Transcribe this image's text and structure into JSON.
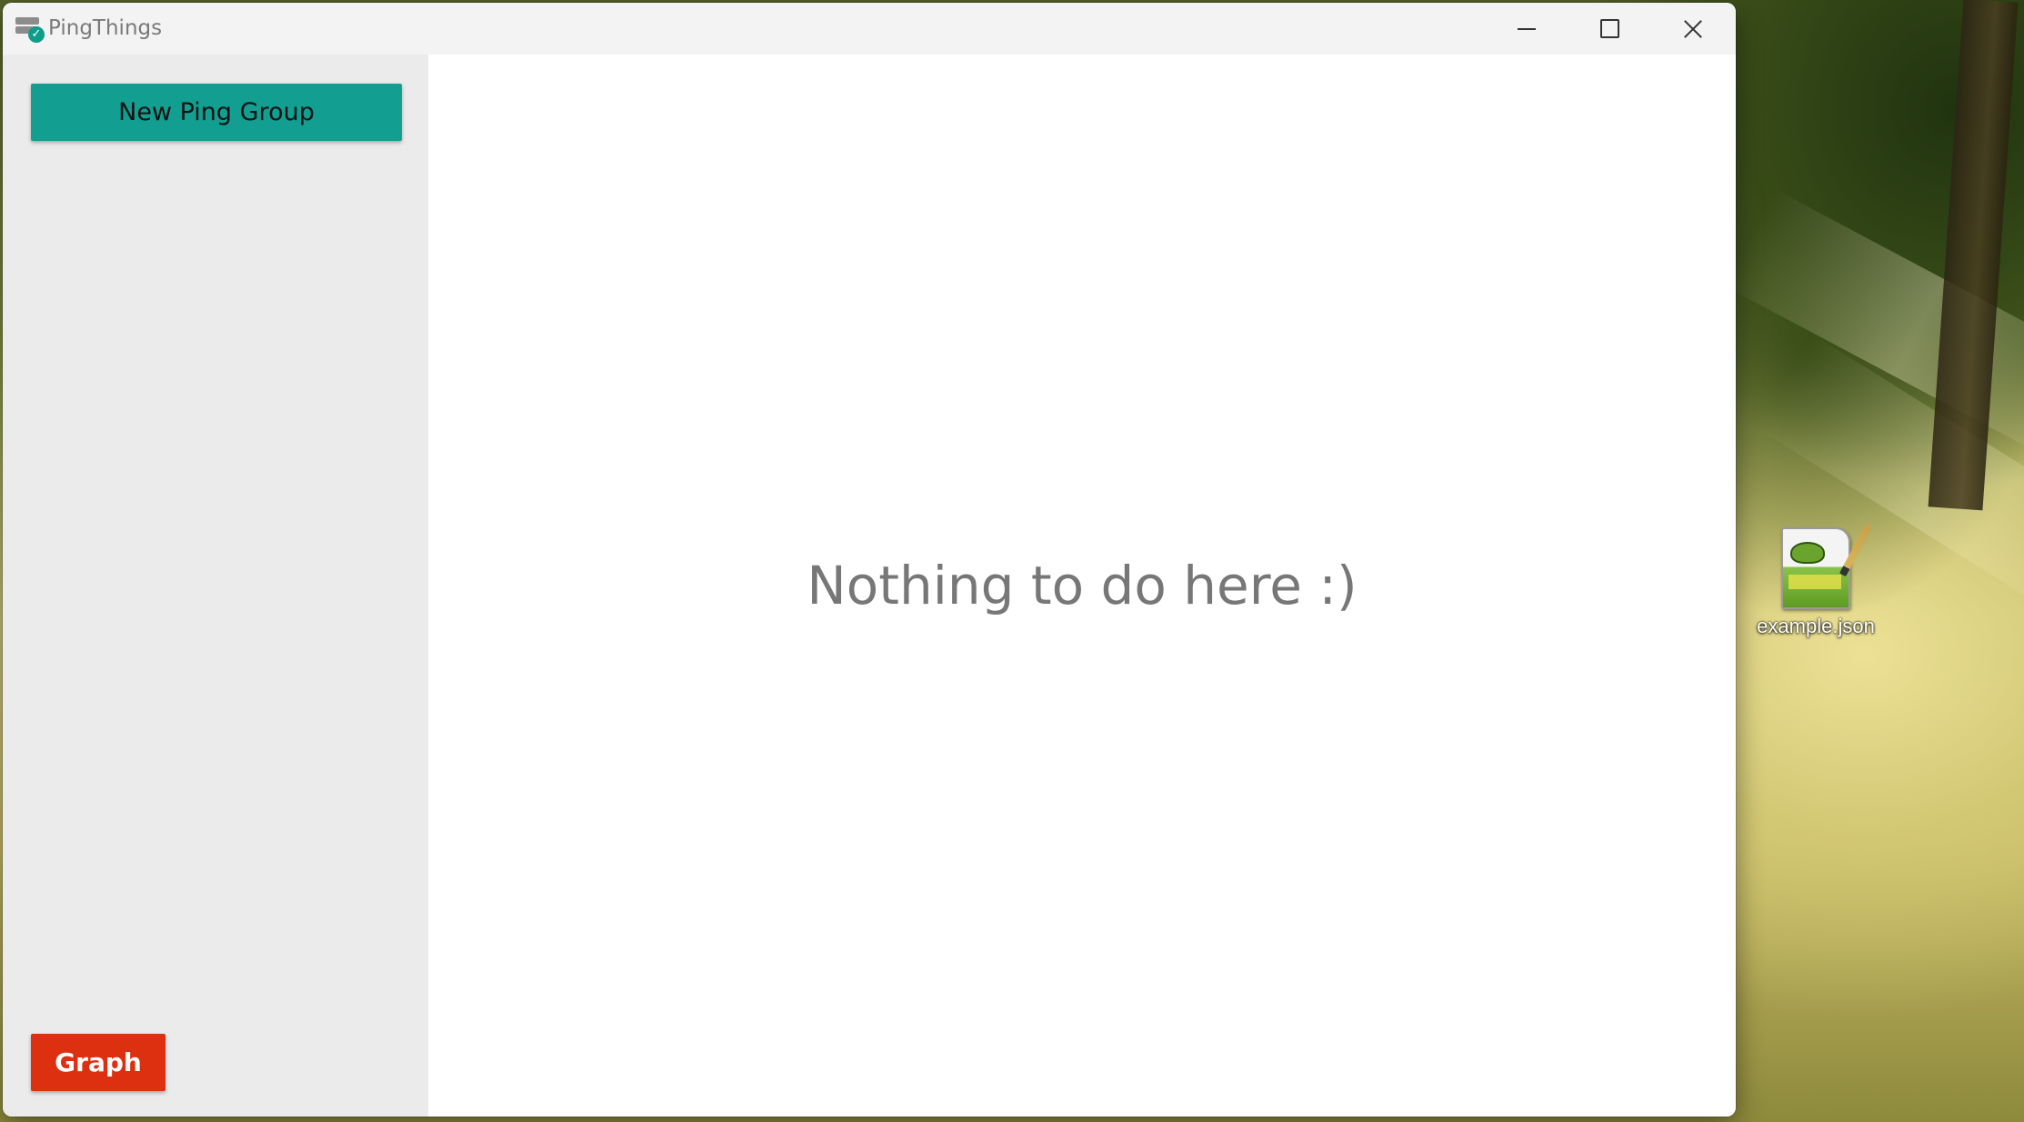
{
  "window": {
    "title": "PingThings",
    "app_icon": "server-check-icon",
    "controls": {
      "minimize": "minimize-icon",
      "maximize": "maximize-icon",
      "close": "close-icon"
    }
  },
  "sidebar": {
    "new_group_label": "New Ping Group",
    "graph_label": "Graph"
  },
  "main": {
    "empty_message": "Nothing to do here  :)"
  },
  "desktop": {
    "icons": [
      {
        "label": "example.json",
        "icon": "notepad-plus-plus-file-icon"
      }
    ]
  },
  "colors": {
    "new_group_button": "#129e90",
    "graph_button": "#dc3010",
    "sidebar_background": "#ebebeb",
    "titlebar_background": "#f3f3f3",
    "empty_message_text": "#777777"
  }
}
